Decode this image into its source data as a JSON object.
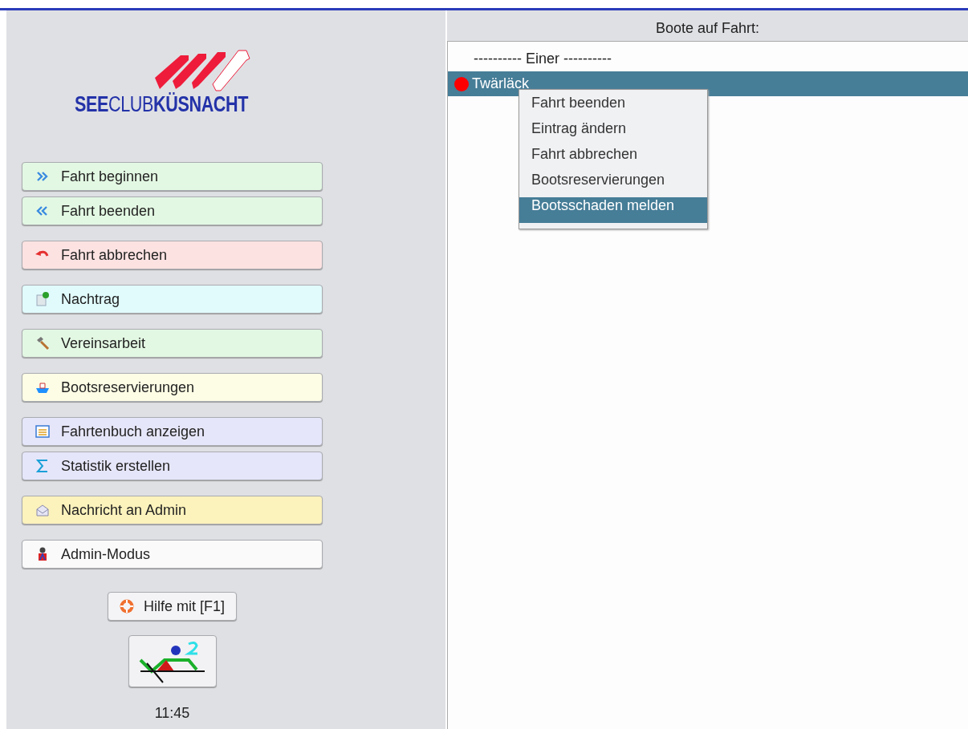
{
  "logo": {
    "text": "**SEE**CLUB**KÜSNACHT**"
  },
  "button_groups": [
    [
      {
        "label": "Fahrt beginnen",
        "color": "#e3f8e3"
      },
      {
        "label": "Fahrt beenden",
        "color": "#e3f8e3"
      }
    ],
    [
      {
        "label": "Fahrt abbrechen",
        "color": "#fde2e2"
      }
    ],
    [
      {
        "label": "Nachtrag",
        "color": "#e1fbfd"
      }
    ],
    [
      {
        "label": "Vereinsarbeit",
        "color": "#e3f8e3"
      }
    ],
    [
      {
        "label": "Bootsreservierungen",
        "color": "#fdfde5"
      }
    ],
    [
      {
        "label": "Fahrtenbuch anzeigen",
        "color": "#e6e6fa"
      },
      {
        "label": "Statistik erstellen",
        "color": "#e6e6fa"
      }
    ],
    [
      {
        "label": "Nachricht an Admin",
        "color": "#fcf2bc"
      }
    ],
    [
      {
        "label": "Admin-Modus",
        "color": "#fafafa"
      }
    ]
  ],
  "help_button": {
    "label": "Hilfe mit [F1]"
  },
  "clock": "11:45",
  "boats_panel": {
    "title": "Boote auf Fahrt:",
    "rows": [
      {
        "kind": "group",
        "label": "---------- Einer ----------",
        "selected": false
      },
      {
        "kind": "boat",
        "label": "Twärläck",
        "selected": true,
        "color": "#ff0000"
      }
    ]
  },
  "context_menu": [
    {
      "label": "Fahrt beenden",
      "selected": false
    },
    {
      "label": "Eintrag ändern",
      "selected": false
    },
    {
      "label": "Fahrt abbrechen",
      "selected": false
    },
    {
      "label": "Bootsreservierungen",
      "selected": false
    },
    {
      "label": "Bootsschaden melden",
      "selected": true
    }
  ]
}
